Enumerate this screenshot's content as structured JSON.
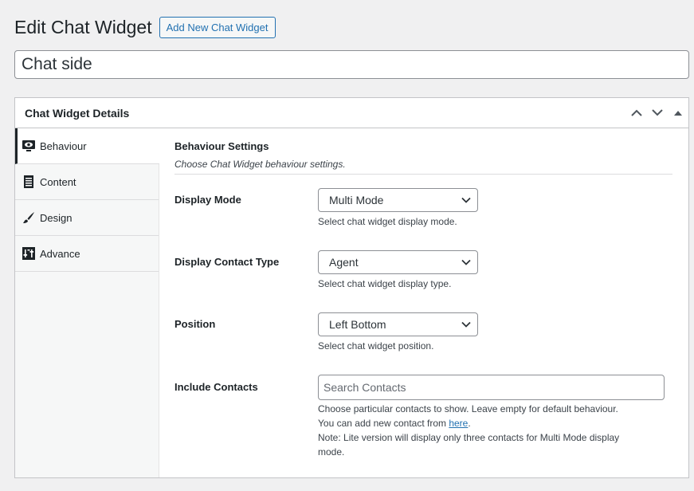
{
  "header": {
    "title": "Edit Chat Widget",
    "add_new_label": "Add New Chat Widget"
  },
  "post_title": "Chat side",
  "postbox": {
    "title": "Chat Widget Details"
  },
  "tabs": [
    {
      "label": "Behaviour",
      "icon": "visibility-icon",
      "active": true
    },
    {
      "label": "Content",
      "icon": "document-icon",
      "active": false
    },
    {
      "label": "Design",
      "icon": "brush-icon",
      "active": false
    },
    {
      "label": "Advance",
      "icon": "admin-tools-icon",
      "active": false
    }
  ],
  "section": {
    "title": "Behaviour Settings",
    "description": "Choose Chat Widget behaviour settings."
  },
  "fields": {
    "display_mode": {
      "label": "Display Mode",
      "value": "Multi Mode",
      "help": "Select chat widget display mode."
    },
    "display_contact_type": {
      "label": "Display Contact Type",
      "value": "Agent",
      "help": "Select chat widget display type."
    },
    "position": {
      "label": "Position",
      "value": "Left Bottom",
      "help": "Select chat widget position."
    },
    "include_contacts": {
      "label": "Include Contacts",
      "placeholder": "Search Contacts",
      "help_line1": "Choose particular contacts to show. Leave empty for default behaviour.",
      "help_line2_prefix": "You can add new contact from ",
      "help_line2_link": "here",
      "help_line2_suffix": ".",
      "help_line3": "Note: Lite version will display only three contacts for Multi Mode display",
      "help_line4": "mode."
    }
  },
  "colors": {
    "accent": "#2271b1",
    "background": "#f0f0f1",
    "text": "#1d2327"
  }
}
